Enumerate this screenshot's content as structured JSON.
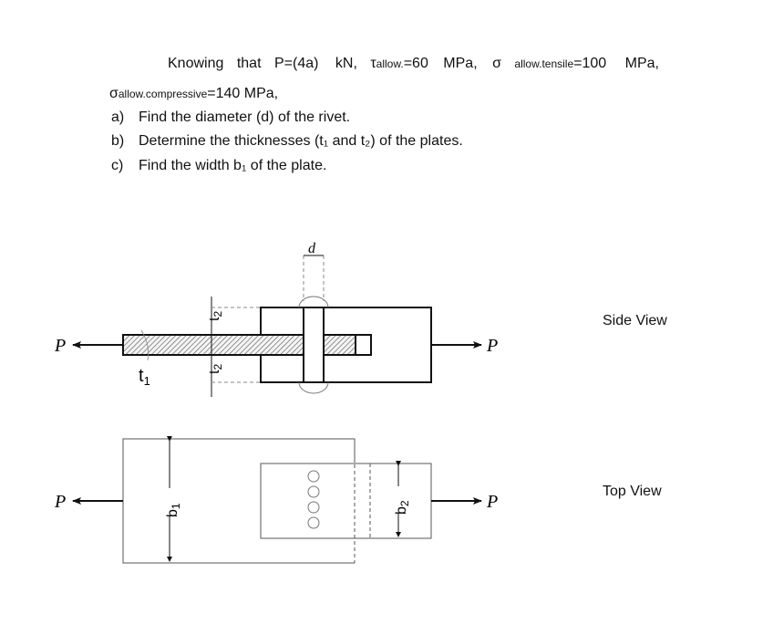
{
  "problem": {
    "intro_word": "Knowing",
    "that_word": "that",
    "load": "P=(4a)",
    "load_unit": "kN,",
    "tau_symbol": "τ",
    "tau_sub": "allow.",
    "tau_value": "=60",
    "tau_unit": "MPa,",
    "sigma_t_symbol": "σ",
    "sigma_t_sub": "allow.tensile",
    "sigma_t_value": "=100",
    "sigma_t_unit": "MPa,",
    "sigma_c_symbol": "σ",
    "sigma_c_sub": "allow.compressive",
    "sigma_c_value": "=140 MPa,"
  },
  "questions": [
    {
      "label": "a)",
      "text": "Find the diameter (d) of the rivet."
    },
    {
      "label": "b)",
      "text": "Determine the thicknesses (t₁ and t₂) of the plates."
    },
    {
      "label": "c)",
      "text": "Find the width b₁ of the plate."
    }
  ],
  "figure": {
    "side_view_label": "Side View",
    "top_view_label": "Top View",
    "force_label": "P",
    "rivet_diameter_label": "d",
    "inner_plate_thickness_label": "t",
    "inner_plate_thickness_sub": "1",
    "outer_plate_thickness_label": "t",
    "outer_plate_thickness_sub": "2",
    "wide_plate_width_label": "b",
    "wide_plate_width_sub": "1",
    "narrow_plate_width_label": "b",
    "narrow_plate_width_sub": "2",
    "rivet_count_top_view": 4
  },
  "colors": {
    "line": "#111111",
    "dashed": "#888888",
    "hatch": "#555555"
  }
}
